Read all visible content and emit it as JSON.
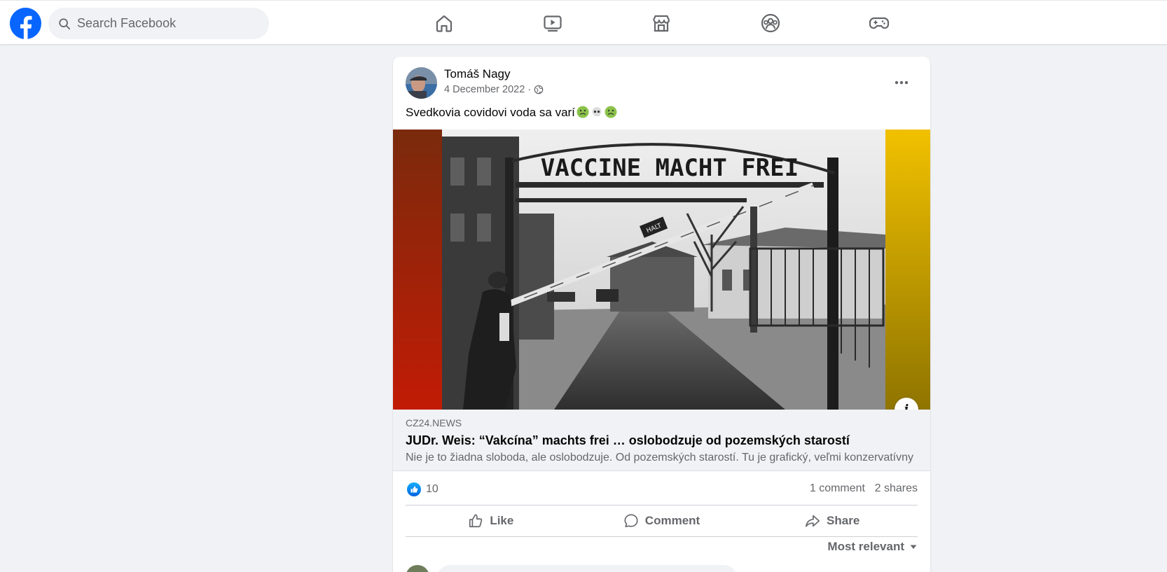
{
  "search": {
    "placeholder": "Search Facebook"
  },
  "nav": [
    {
      "name": "home-icon"
    },
    {
      "name": "watch-icon"
    },
    {
      "name": "marketplace-icon"
    },
    {
      "name": "groups-icon"
    },
    {
      "name": "gaming-icon"
    }
  ],
  "post": {
    "author": "Tomáš Nagy",
    "date": "4 December 2022 ·",
    "audience_icon": "globe-icon",
    "text": "Svedkovia covidovi voda sa varí",
    "text_emojis": [
      "nauseated-face",
      "skull",
      "nauseated-face"
    ],
    "image": {
      "sign_text": "VACCINE MACHT FREI",
      "halt_sign": "HALT"
    },
    "link": {
      "domain": "CZ24.NEWS",
      "title": "JUDr. Weis: “Vakcína” machts frei … oslobodzuje od pozemských starostí",
      "description": "Nie je to žiadna sloboda, ale oslobodzuje. Od pozemských starostí. Tu je grafický, veľmi konzervatívny"
    },
    "reactions": {
      "count": "10"
    },
    "comments_count": "1 comment",
    "shares_count": "2 shares",
    "actions": {
      "like": "Like",
      "comment": "Comment",
      "share": "Share"
    },
    "sort": "Most relevant"
  },
  "colors": {
    "brand": "#0866ff",
    "background": "#f0f2f5"
  }
}
